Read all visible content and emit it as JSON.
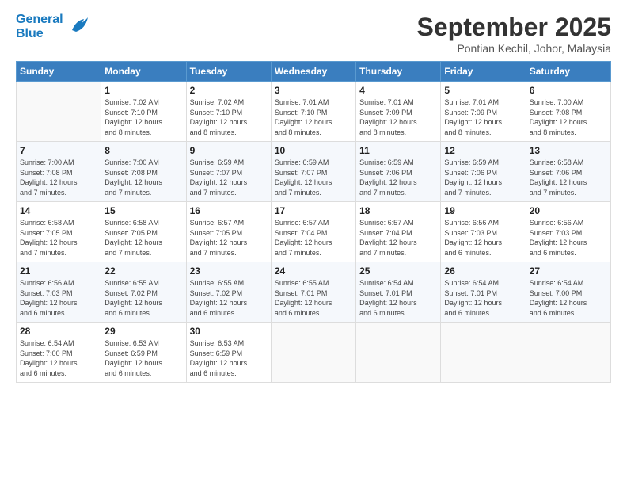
{
  "logo": {
    "line1": "General",
    "line2": "Blue"
  },
  "title": "September 2025",
  "subtitle": "Pontian Kechil, Johor, Malaysia",
  "days_header": [
    "Sunday",
    "Monday",
    "Tuesday",
    "Wednesday",
    "Thursday",
    "Friday",
    "Saturday"
  ],
  "weeks": [
    [
      {
        "num": "",
        "info": ""
      },
      {
        "num": "1",
        "info": "Sunrise: 7:02 AM\nSunset: 7:10 PM\nDaylight: 12 hours\nand 8 minutes."
      },
      {
        "num": "2",
        "info": "Sunrise: 7:02 AM\nSunset: 7:10 PM\nDaylight: 12 hours\nand 8 minutes."
      },
      {
        "num": "3",
        "info": "Sunrise: 7:01 AM\nSunset: 7:10 PM\nDaylight: 12 hours\nand 8 minutes."
      },
      {
        "num": "4",
        "info": "Sunrise: 7:01 AM\nSunset: 7:09 PM\nDaylight: 12 hours\nand 8 minutes."
      },
      {
        "num": "5",
        "info": "Sunrise: 7:01 AM\nSunset: 7:09 PM\nDaylight: 12 hours\nand 8 minutes."
      },
      {
        "num": "6",
        "info": "Sunrise: 7:00 AM\nSunset: 7:08 PM\nDaylight: 12 hours\nand 8 minutes."
      }
    ],
    [
      {
        "num": "7",
        "info": "Sunrise: 7:00 AM\nSunset: 7:08 PM\nDaylight: 12 hours\nand 7 minutes."
      },
      {
        "num": "8",
        "info": "Sunrise: 7:00 AM\nSunset: 7:08 PM\nDaylight: 12 hours\nand 7 minutes."
      },
      {
        "num": "9",
        "info": "Sunrise: 6:59 AM\nSunset: 7:07 PM\nDaylight: 12 hours\nand 7 minutes."
      },
      {
        "num": "10",
        "info": "Sunrise: 6:59 AM\nSunset: 7:07 PM\nDaylight: 12 hours\nand 7 minutes."
      },
      {
        "num": "11",
        "info": "Sunrise: 6:59 AM\nSunset: 7:06 PM\nDaylight: 12 hours\nand 7 minutes."
      },
      {
        "num": "12",
        "info": "Sunrise: 6:59 AM\nSunset: 7:06 PM\nDaylight: 12 hours\nand 7 minutes."
      },
      {
        "num": "13",
        "info": "Sunrise: 6:58 AM\nSunset: 7:06 PM\nDaylight: 12 hours\nand 7 minutes."
      }
    ],
    [
      {
        "num": "14",
        "info": "Sunrise: 6:58 AM\nSunset: 7:05 PM\nDaylight: 12 hours\nand 7 minutes."
      },
      {
        "num": "15",
        "info": "Sunrise: 6:58 AM\nSunset: 7:05 PM\nDaylight: 12 hours\nand 7 minutes."
      },
      {
        "num": "16",
        "info": "Sunrise: 6:57 AM\nSunset: 7:05 PM\nDaylight: 12 hours\nand 7 minutes."
      },
      {
        "num": "17",
        "info": "Sunrise: 6:57 AM\nSunset: 7:04 PM\nDaylight: 12 hours\nand 7 minutes."
      },
      {
        "num": "18",
        "info": "Sunrise: 6:57 AM\nSunset: 7:04 PM\nDaylight: 12 hours\nand 7 minutes."
      },
      {
        "num": "19",
        "info": "Sunrise: 6:56 AM\nSunset: 7:03 PM\nDaylight: 12 hours\nand 6 minutes."
      },
      {
        "num": "20",
        "info": "Sunrise: 6:56 AM\nSunset: 7:03 PM\nDaylight: 12 hours\nand 6 minutes."
      }
    ],
    [
      {
        "num": "21",
        "info": "Sunrise: 6:56 AM\nSunset: 7:03 PM\nDaylight: 12 hours\nand 6 minutes."
      },
      {
        "num": "22",
        "info": "Sunrise: 6:55 AM\nSunset: 7:02 PM\nDaylight: 12 hours\nand 6 minutes."
      },
      {
        "num": "23",
        "info": "Sunrise: 6:55 AM\nSunset: 7:02 PM\nDaylight: 12 hours\nand 6 minutes."
      },
      {
        "num": "24",
        "info": "Sunrise: 6:55 AM\nSunset: 7:01 PM\nDaylight: 12 hours\nand 6 minutes."
      },
      {
        "num": "25",
        "info": "Sunrise: 6:54 AM\nSunset: 7:01 PM\nDaylight: 12 hours\nand 6 minutes."
      },
      {
        "num": "26",
        "info": "Sunrise: 6:54 AM\nSunset: 7:01 PM\nDaylight: 12 hours\nand 6 minutes."
      },
      {
        "num": "27",
        "info": "Sunrise: 6:54 AM\nSunset: 7:00 PM\nDaylight: 12 hours\nand 6 minutes."
      }
    ],
    [
      {
        "num": "28",
        "info": "Sunrise: 6:54 AM\nSunset: 7:00 PM\nDaylight: 12 hours\nand 6 minutes."
      },
      {
        "num": "29",
        "info": "Sunrise: 6:53 AM\nSunset: 6:59 PM\nDaylight: 12 hours\nand 6 minutes."
      },
      {
        "num": "30",
        "info": "Sunrise: 6:53 AM\nSunset: 6:59 PM\nDaylight: 12 hours\nand 6 minutes."
      },
      {
        "num": "",
        "info": ""
      },
      {
        "num": "",
        "info": ""
      },
      {
        "num": "",
        "info": ""
      },
      {
        "num": "",
        "info": ""
      }
    ]
  ]
}
